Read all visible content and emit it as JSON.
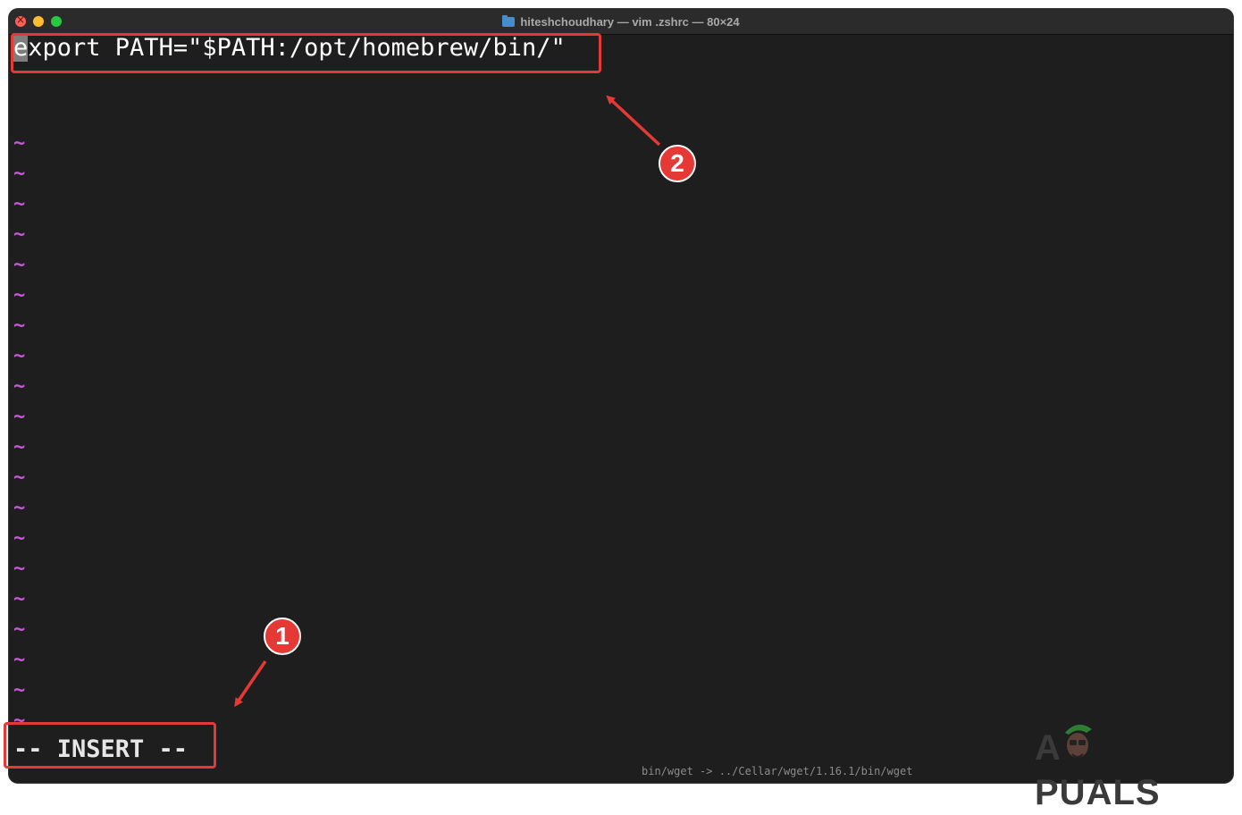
{
  "window": {
    "title": "hiteshchoudhary — vim .zshrc — 80×24",
    "title_icon": "folder-icon"
  },
  "editor": {
    "cursor_char": "e",
    "line_rest": "xport PATH=\"$PATH:/opt/homebrew/bin/\"",
    "tilde": "~",
    "mode": "-- INSERT --",
    "bottom_text": "bin/wget -> ../Cellar/wget/1.16.1/bin/wget"
  },
  "annotations": {
    "badge_1": "1",
    "badge_2": "2",
    "color": "#e53935"
  },
  "watermark": {
    "text_a": "A",
    "text_rest": "PUALS"
  },
  "colors": {
    "background": "#1e1e1e",
    "tilde": "#c55bd6",
    "titlebar": "#2b2b2b"
  }
}
